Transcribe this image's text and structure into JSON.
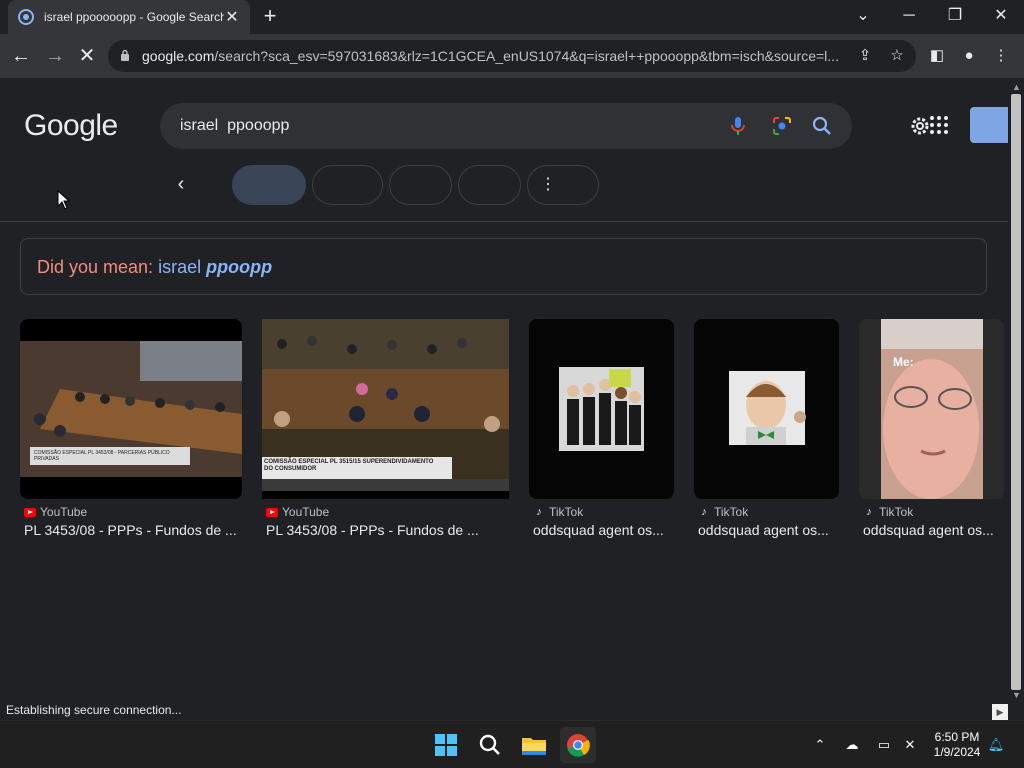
{
  "browser": {
    "tab_title": "israel ppooooopp - Google Search",
    "tab_close": "✕",
    "new_tab": "+",
    "url_host": "google.com",
    "url_rest": "/search?sca_esv=597031683&rlz=1C1GCEA_enUS1074&q=israel++ppooopp&tbm=isch&source=l...",
    "window_controls": [
      "minimize",
      "restore",
      "close"
    ]
  },
  "search": {
    "logo": "Google",
    "query": "israel  ppooopp"
  },
  "did_you_mean": {
    "label": "Did you mean:",
    "suggestion_plain": "israel",
    "suggestion_bold": "ppoopp"
  },
  "results": [
    {
      "source": "YouTube",
      "source_icon": "youtube-icon",
      "title": "PL 3453/08 - PPPs - Fundos de ...",
      "thumb_caption": "COMISSÃO ESPECIAL PL 3453/08 - PARCERIAS PÚBLICO PRIVADAS"
    },
    {
      "source": "YouTube",
      "source_icon": "youtube-icon",
      "title": "PL 3453/08 - PPPs - Fundos de ...",
      "thumb_caption": "COMISSÃO ESPECIAL PL 3515/15 SUPERENDIVIDAMENTO DO CONSUMIDOR"
    },
    {
      "source": "TikTok",
      "source_icon": "tiktok-icon",
      "title": "oddsquad agent os..."
    },
    {
      "source": "TikTok",
      "source_icon": "tiktok-icon",
      "title": "oddsquad agent os..."
    },
    {
      "source": "TikTok",
      "source_icon": "tiktok-icon",
      "title": "oddsquad agent os...",
      "thumb_caption": "Me:"
    }
  ],
  "status_bar": "Establishing secure connection...",
  "taskbar": {
    "time": "6:50 PM",
    "date": "1/9/2024"
  },
  "colors": {
    "background": "#202124",
    "accent": "#8ab4f8",
    "did_you_mean_label": "#f28b82"
  }
}
